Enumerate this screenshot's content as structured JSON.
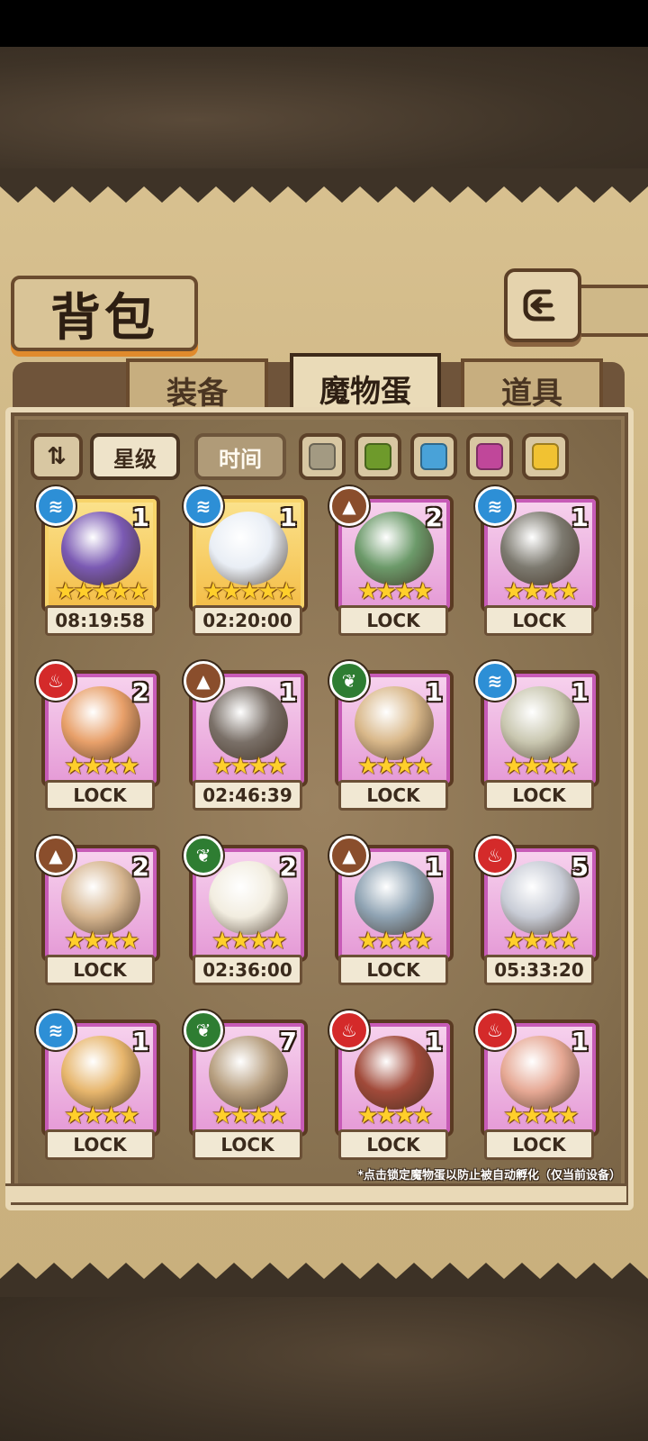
{
  "title": "背包",
  "tabs": [
    {
      "label": "装备",
      "active": false
    },
    {
      "label": "魔物蛋",
      "active": true
    },
    {
      "label": "道具",
      "active": false
    }
  ],
  "toolbar": {
    "sort_icon": "sort-toggle-icon",
    "filters": [
      {
        "label": "星级",
        "active": true
      },
      {
        "label": "时间",
        "active": false
      }
    ],
    "color_filters": [
      {
        "name": "gray",
        "color": "#a39a82"
      },
      {
        "name": "green",
        "color": "#6e9a2b"
      },
      {
        "name": "blue",
        "color": "#49a2d8"
      },
      {
        "name": "pink",
        "color": "#c0479a"
      },
      {
        "name": "yellow",
        "color": "#f1c232"
      }
    ]
  },
  "eggs": [
    {
      "element": "water",
      "rarity": "gold",
      "count": "1",
      "stars": "★★★★★",
      "status": "08:19:58",
      "art": "pocket-watch-icon",
      "art_color": "#7b5ab3"
    },
    {
      "element": "water",
      "rarity": "gold",
      "count": "1",
      "stars": "★★★★★",
      "status": "02:20:00",
      "art": "feathered-egg-icon",
      "art_color": "#e9eef5"
    },
    {
      "element": "earth",
      "rarity": "pink",
      "count": "2",
      "stars": "★★★★",
      "status": "LOCK",
      "art": "green-orb-icon",
      "art_color": "#6c9a6a"
    },
    {
      "element": "water",
      "rarity": "pink",
      "count": "1",
      "stars": "★★★★",
      "status": "LOCK",
      "art": "spiky-egg-icon",
      "art_color": "#7d7a70"
    },
    {
      "element": "fire",
      "rarity": "pink",
      "count": "2",
      "stars": "★★★★",
      "status": "LOCK",
      "art": "crowned-egg-icon",
      "art_color": "#e8a06a"
    },
    {
      "element": "earth",
      "rarity": "pink",
      "count": "1",
      "stars": "★★★★",
      "status": "02:46:39",
      "art": "mechanical-egg-icon",
      "art_color": "#7a7068"
    },
    {
      "element": "leaf",
      "rarity": "pink",
      "count": "1",
      "stars": "★★★★",
      "status": "LOCK",
      "art": "nest-egg-icon",
      "art_color": "#d9b88a"
    },
    {
      "element": "water",
      "rarity": "pink",
      "count": "1",
      "stars": "★★★★",
      "status": "LOCK",
      "art": "leaf-egg-icon",
      "art_color": "#c9c7b0"
    },
    {
      "element": "earth",
      "rarity": "pink",
      "count": "2",
      "stars": "★★★★",
      "status": "LOCK",
      "art": "vine-egg-icon",
      "art_color": "#d6b58f"
    },
    {
      "element": "leaf",
      "rarity": "pink",
      "count": "2",
      "stars": "★★★★",
      "status": "02:36:00",
      "art": "winged-egg-icon",
      "art_color": "#f2ede0"
    },
    {
      "element": "earth",
      "rarity": "pink",
      "count": "1",
      "stars": "★★★★",
      "status": "LOCK",
      "art": "scaled-egg-icon",
      "art_color": "#8fa3b3"
    },
    {
      "element": "fire",
      "rarity": "pink",
      "count": "5",
      "stars": "★★★★",
      "status": "05:33:20",
      "art": "dagger-icon",
      "art_color": "#c8ccd6"
    },
    {
      "element": "water",
      "rarity": "pink",
      "count": "1",
      "stars": "★★★★",
      "status": "LOCK",
      "art": "jelly-egg-icon",
      "art_color": "#e7b66d"
    },
    {
      "element": "leaf",
      "rarity": "pink",
      "count": "7",
      "stars": "★★★★",
      "status": "LOCK",
      "art": "plant-egg-icon",
      "art_color": "#b79f80"
    },
    {
      "element": "fire",
      "rarity": "pink",
      "count": "1",
      "stars": "★★★★",
      "status": "LOCK",
      "art": "flame-egg-icon",
      "art_color": "#a14a3a"
    },
    {
      "element": "fire",
      "rarity": "pink",
      "count": "1",
      "stars": "★★★★",
      "status": "LOCK",
      "art": "floral-egg-icon",
      "art_color": "#e6a894"
    }
  ],
  "hint": "*点击锁定魔物蛋以防止被自动孵化（仅当前设备）"
}
